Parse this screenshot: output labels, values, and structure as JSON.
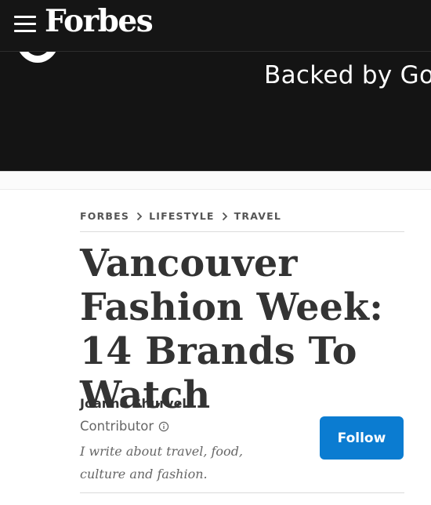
{
  "header": {
    "brand": "Forbes",
    "menu_icon": "hamburger-menu-icon"
  },
  "ad": {
    "tagline": "Backed by Go",
    "logo_icon": "godaddy-logo"
  },
  "breadcrumb": {
    "items": [
      "FORBES",
      "LIFESTYLE",
      "TRAVEL"
    ],
    "separator_icon": "chevron-right-icon"
  },
  "article": {
    "headline": "Vancouver Fashion Week: 14 Brands To Watch"
  },
  "author": {
    "name": "Joanne Shurvell",
    "role": "Contributor",
    "role_info_icon": "info-circle-icon",
    "bio": "I write about travel, food, culture and fashion.",
    "follow_label": "Follow"
  },
  "colors": {
    "topbar": "#151515",
    "accent": "#0b7cd1",
    "headline": "#333333"
  }
}
